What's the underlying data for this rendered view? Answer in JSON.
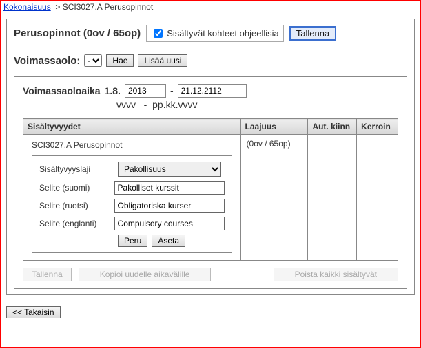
{
  "breadcrumb": {
    "root_label": "Kokonaisuus",
    "sep": ">",
    "current": "SCI3027.A Perusopinnot"
  },
  "header": {
    "title": "Perusopinnot (0ov / 65op)",
    "checkbox_label": "Sisältyvät kohteet ohjeellisia",
    "checkbox_checked": true,
    "save_label": "Tallenna"
  },
  "validity": {
    "label": "Voimassaolo:",
    "select_value": "-",
    "hae_label": "Hae",
    "lisaa_uusi_label": "Lisää uusi"
  },
  "period": {
    "label": "Voimassaoloaika",
    "prefix": "1.8.",
    "year": "2013",
    "dash": "-",
    "end": "21.12.2112",
    "hint_year": "vvvv",
    "hint_dash": "-",
    "hint_date": "pp.kk.vvvv"
  },
  "grid": {
    "headers": {
      "sisaltyvyydet": "Sisältyvyydet",
      "laajuus": "Laajuus",
      "aut_kiinn": "Aut. kiinn",
      "kerroin": "Kerroin"
    },
    "row": {
      "title": "SCI3027.A Perusopinnot",
      "laajuus": "(0ov / 65op)"
    }
  },
  "form": {
    "labels": {
      "laji": "Sisältyvyyslaji",
      "selite_fi": "Selite (suomi)",
      "selite_sv": "Selite (ruotsi)",
      "selite_en": "Selite (englanti)"
    },
    "values": {
      "laji": "Pakollisuus",
      "selite_fi": "Pakolliset kurssit",
      "selite_sv": "Obligatoriska kurser",
      "selite_en": "Compulsory courses"
    },
    "buttons": {
      "peru": "Peru",
      "aseta": "Aseta"
    }
  },
  "bottom": {
    "tallenna": "Tallenna",
    "kopioi": "Kopioi uudelle aikavälille",
    "poista": "Poista kaikki sisältyvät"
  },
  "back": {
    "label": "<< Takaisin"
  }
}
